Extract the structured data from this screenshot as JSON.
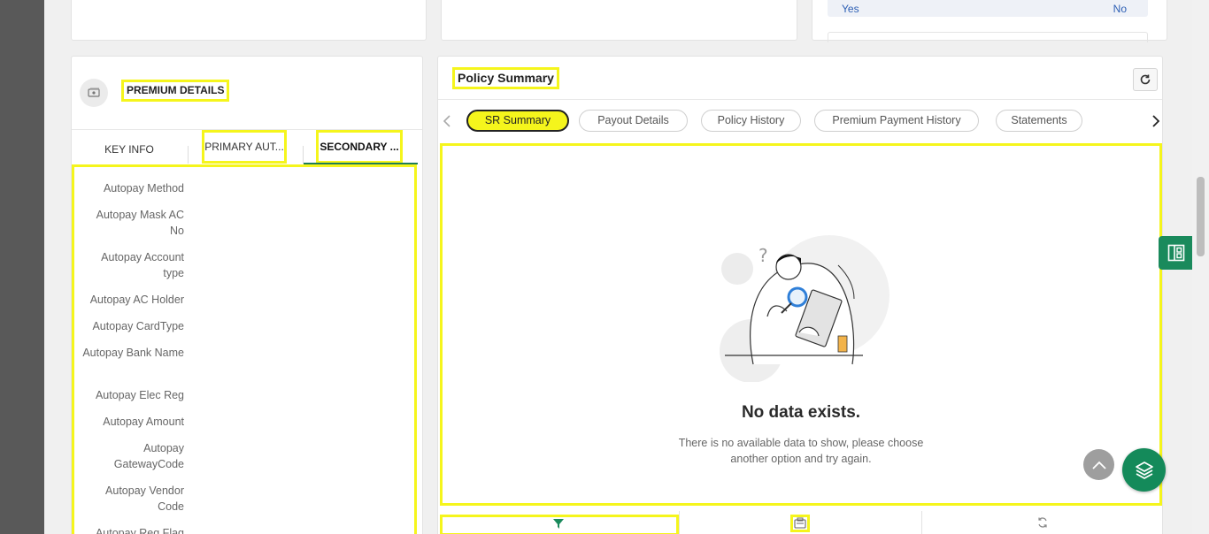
{
  "top_cards": {
    "yes_label": "Yes",
    "no_label": "No"
  },
  "premium": {
    "title": "PREMIUM DETAILS",
    "icon": "money-icon",
    "tabs": [
      "KEY INFO",
      "PRIMARY AUT...",
      "SECONDARY ..."
    ],
    "active_tab": "SECONDARY ...",
    "fields": [
      "Autopay Method",
      "Autopay Mask AC No",
      "Autopay Account type",
      "Autopay AC Holder",
      "Autopay CardType",
      "Autopay Bank Name",
      "Autopay Elec Reg",
      "Autopay Amount",
      "Autopay GatewayCode",
      "Autopay Vendor Code",
      "Autopay Reg Flag"
    ]
  },
  "policy": {
    "title": "Policy Summary",
    "tabs": [
      "SR Summary",
      "Payout Details",
      "Policy History",
      "Premium Payment History",
      "Statements"
    ],
    "active_tab": "SR Summary",
    "empty_title": "No data exists.",
    "empty_message": "There is no available data to show, please choose another option and try again.",
    "bottom_icons": [
      "filter-icon",
      "list-icon",
      "sync-icon"
    ]
  },
  "colors": {
    "accent_green": "#1a8a5c",
    "highlight_yellow": "#f5f51c",
    "link_blue": "#2d5fb4"
  }
}
